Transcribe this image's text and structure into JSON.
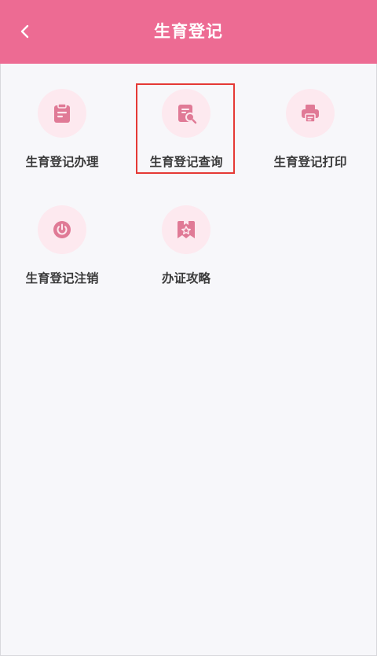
{
  "header": {
    "title": "生育登记",
    "back_icon": "chevron-left-icon"
  },
  "colors": {
    "header_bg": "#ed6b93",
    "icon_circle_bg": "#fde9ef",
    "icon_color": "#e07a96",
    "highlight_border": "#e53935",
    "page_bg": "#f7f7fa"
  },
  "menu": {
    "items": [
      {
        "label": "生育登记办理",
        "icon": "clipboard-icon"
      },
      {
        "label": "生育登记查询",
        "icon": "document-search-icon"
      },
      {
        "label": "生育登记打印",
        "icon": "printer-icon"
      },
      {
        "label": "生育登记注销",
        "icon": "power-icon"
      },
      {
        "label": "办证攻略",
        "icon": "bookmark-star-icon"
      }
    ]
  }
}
